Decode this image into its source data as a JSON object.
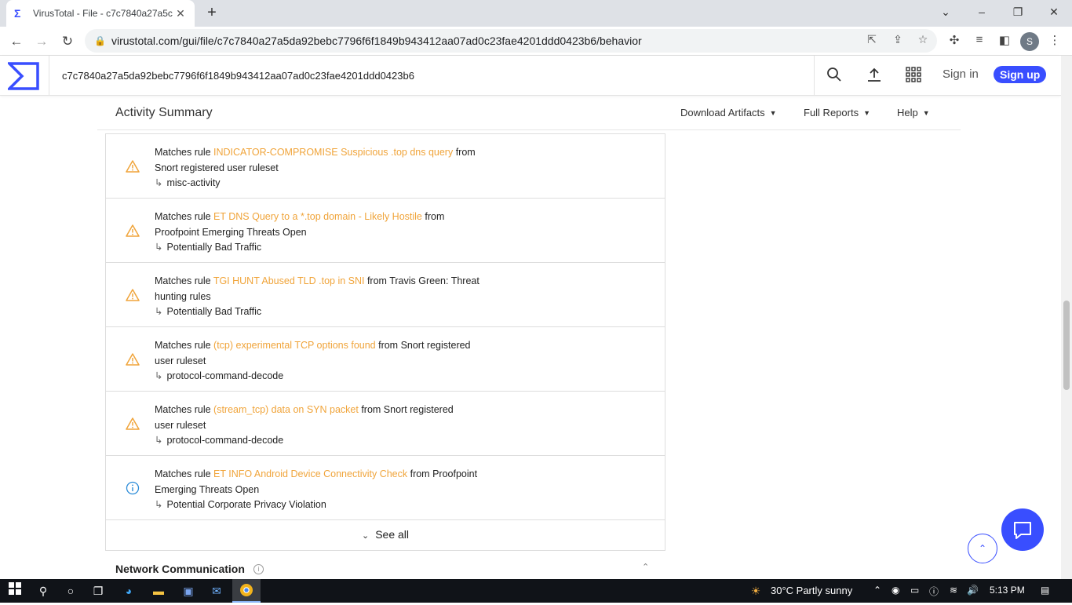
{
  "browser": {
    "tab_title": "VirusTotal - File - c7c7840a27a5c",
    "tab_favicon": "virustotal-icon",
    "url": "virustotal.com/gui/file/c7c7840a27a5da92bebc7796f6f1849b943412aa07ad0c23fae4201ddd0423b6/behavior",
    "profile_initial": "S"
  },
  "header": {
    "search_value": "c7c7840a27a5da92bebc7796f6f1849b943412aa07ad0c23fae4201ddd0423b6",
    "sign_in": "Sign in",
    "sign_up": "Sign up",
    "brand_color": "#394eff"
  },
  "activity": {
    "title": "Activity Summary",
    "menus": [
      "Download Artifacts",
      "Full Reports",
      "Help"
    ]
  },
  "rules": [
    {
      "severity": "warning",
      "prefix": "Matches rule ",
      "rule": "INDICATOR-COMPROMISE Suspicious .top dns query",
      "suffix1": " from",
      "line2": "Snort registered user ruleset",
      "category": "misc-activity"
    },
    {
      "severity": "warning",
      "prefix": "Matches rule ",
      "rule": "ET DNS Query to a *.top domain - Likely Hostile",
      "suffix1": " from",
      "line2": "Proofpoint Emerging Threats Open",
      "category": "Potentially Bad Traffic"
    },
    {
      "severity": "warning",
      "prefix": "Matches rule ",
      "rule": "TGI HUNT Abused TLD .top in SNI",
      "suffix1": " from Travis Green: Threat",
      "line2": "hunting rules",
      "category": "Potentially Bad Traffic"
    },
    {
      "severity": "warning",
      "prefix": "Matches rule ",
      "rule": "(tcp) experimental TCP options found",
      "suffix1": " from Snort registered",
      "line2": "user ruleset",
      "category": "protocol-command-decode"
    },
    {
      "severity": "warning",
      "prefix": "Matches rule ",
      "rule": "(stream_tcp) data on SYN packet",
      "suffix1": " from Snort registered",
      "line2": "user ruleset",
      "category": "protocol-command-decode"
    },
    {
      "severity": "info",
      "prefix": "Matches rule ",
      "rule": "ET INFO Android Device Connectivity Check",
      "suffix1": " from Proofpoint",
      "line2": "Emerging Threats Open",
      "category": "Potential Corporate Privacy Violation"
    }
  ],
  "colors": {
    "rule_link": "#f0a43a",
    "warning": "#f0a43a",
    "info": "#2a8bd8"
  },
  "see_all": "See all",
  "network_section": "Network Communication",
  "taskbar": {
    "weather": "30°C  Partly sunny",
    "time": "5:13 PM"
  }
}
